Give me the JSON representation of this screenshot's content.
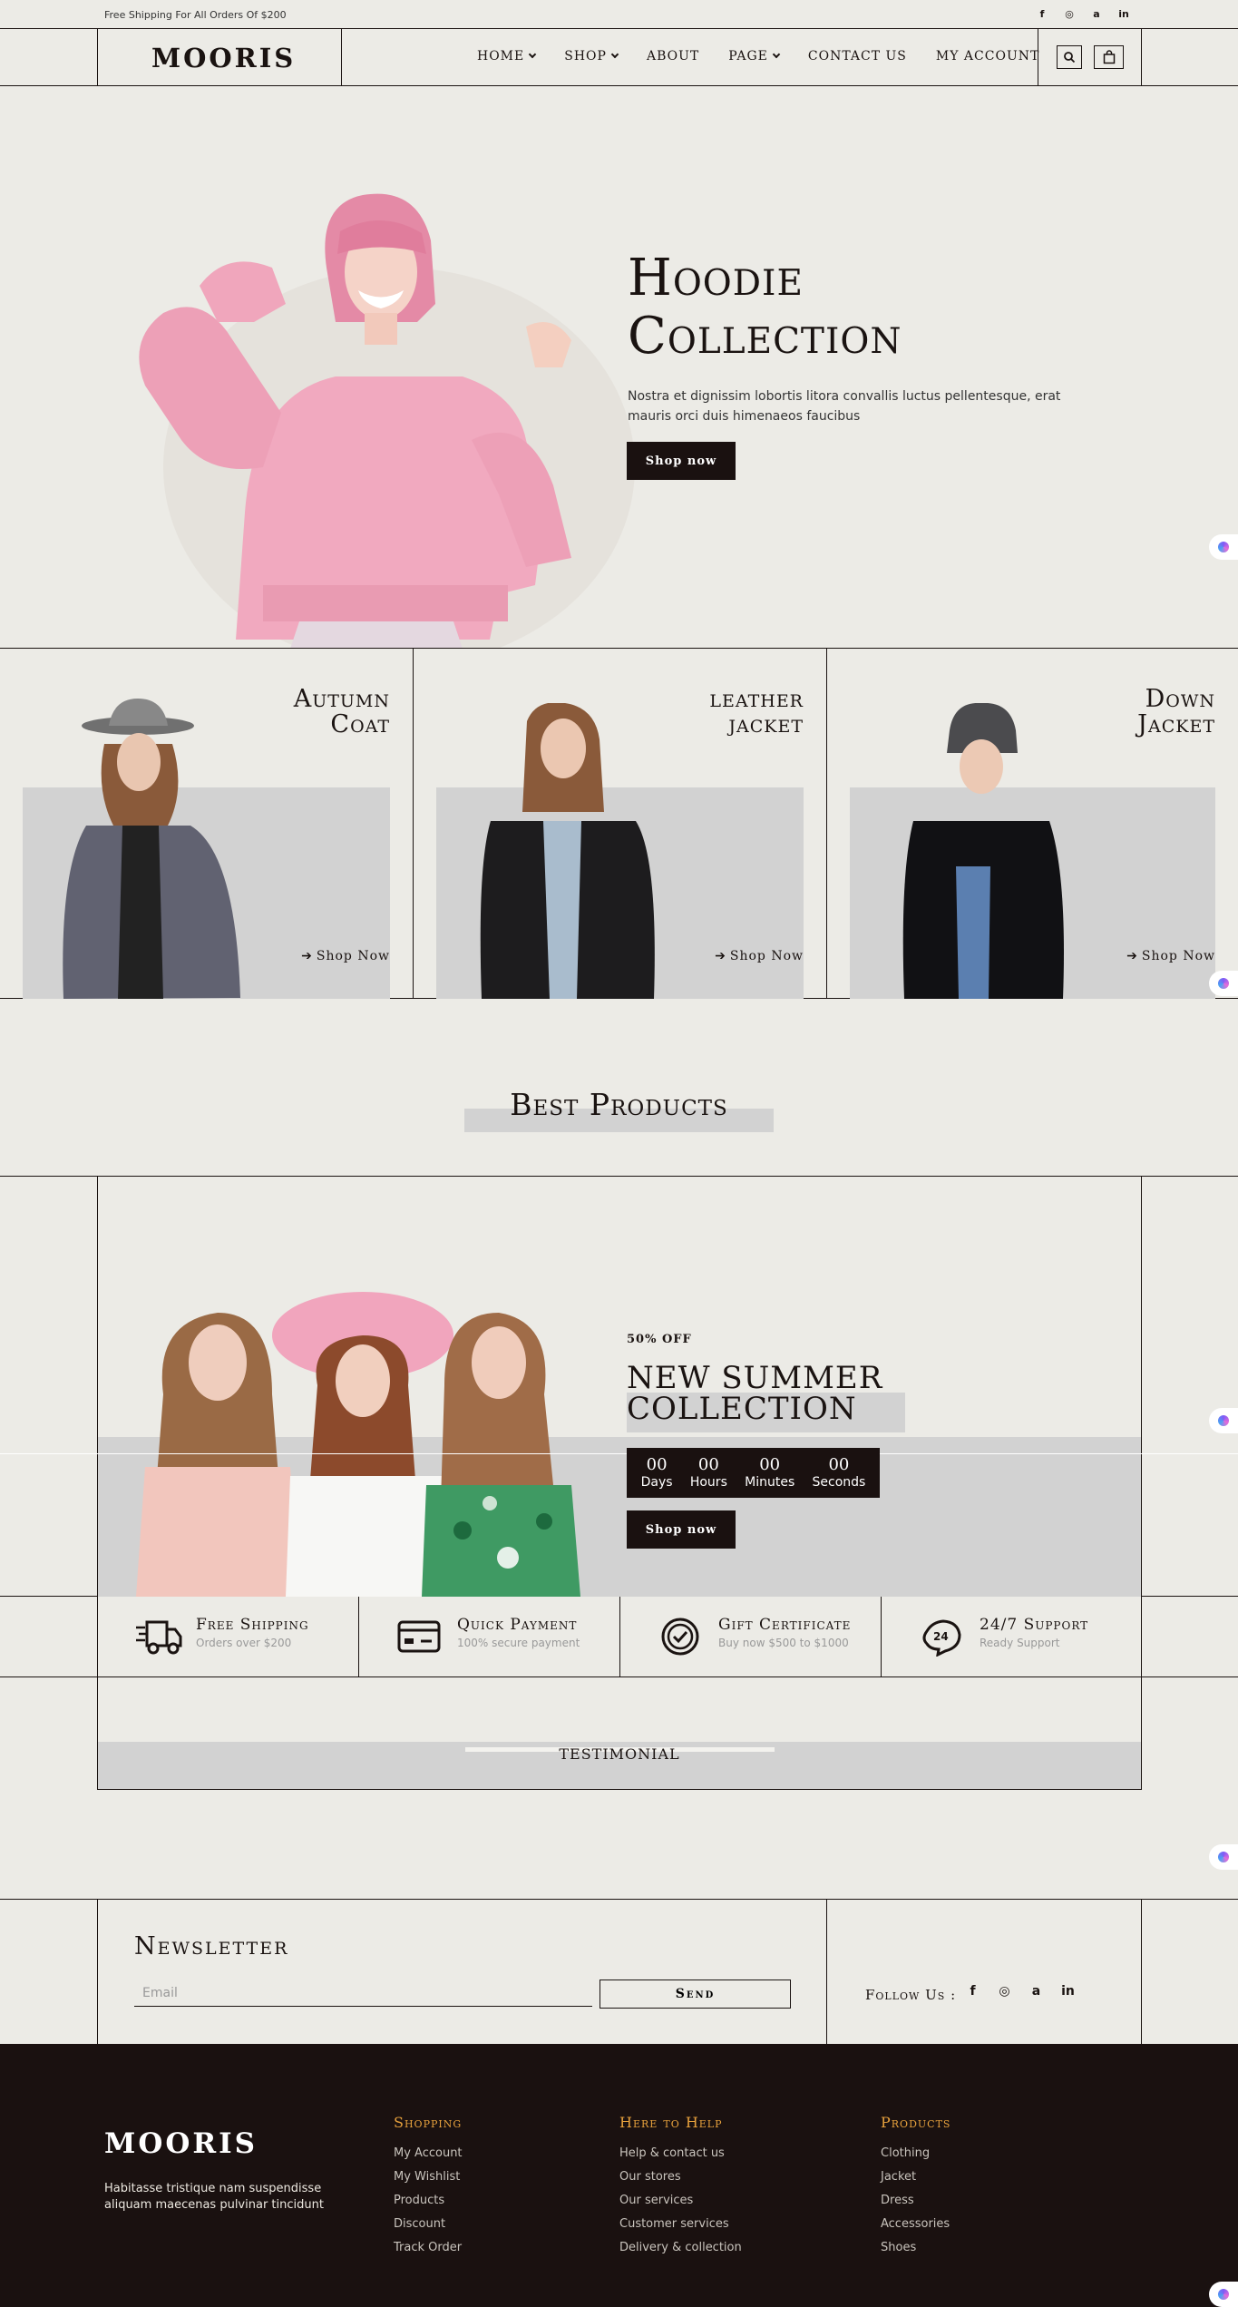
{
  "topbar": {
    "shipping_text": "Free Shipping For All Orders Of $200",
    "socials": [
      "f",
      "◎",
      "a",
      "in"
    ]
  },
  "header": {
    "logo": "MOORIS",
    "nav": [
      {
        "label": "HOME",
        "dropdown": true
      },
      {
        "label": "SHOP",
        "dropdown": true
      },
      {
        "label": "ABOUT",
        "dropdown": false
      },
      {
        "label": "PAGE",
        "dropdown": true
      },
      {
        "label": "CONTACT US",
        "dropdown": false
      },
      {
        "label": "MY ACCOUNT",
        "dropdown": false
      }
    ],
    "icons": [
      "search-icon",
      "shopping-bag-icon"
    ]
  },
  "hero": {
    "title_line1": "Hoodie",
    "title_line2": "Collection",
    "text": "Nostra et dignissim lobortis litora convallis luctus pellentesque, erat mauris orci duis himenaeos faucibus",
    "button": "Shop now"
  },
  "categories": [
    {
      "title_line1": "Autumn",
      "title_line2": "Coat",
      "link": "Shop Now"
    },
    {
      "title_line1": "leather",
      "title_line2": "jacket",
      "link": "Shop Now"
    },
    {
      "title_line1": "Down",
      "title_line2": "Jacket",
      "link": "Shop Now"
    }
  ],
  "best_products": {
    "title": "Best Products"
  },
  "summer": {
    "discount": "50% OFF",
    "title_line1": "NEW SUMMER",
    "title_line2": "COLLECTION",
    "countdown": [
      {
        "value": "00",
        "label": "Days"
      },
      {
        "value": "00",
        "label": "Hours"
      },
      {
        "value": "00",
        "label": "Minutes"
      },
      {
        "value": "00",
        "label": "Seconds"
      }
    ],
    "button": "Shop now"
  },
  "features": [
    {
      "title": "Free Shipping",
      "subtitle": "Orders over $200",
      "icon": "truck-icon"
    },
    {
      "title": "Quick Payment",
      "subtitle": "100% secure payment",
      "icon": "credit-card-icon"
    },
    {
      "title": "Gift Certificate",
      "subtitle": "Buy now $500 to $1000",
      "icon": "check-badge-icon"
    },
    {
      "title": "24/7 Support",
      "subtitle": "Ready Support",
      "icon": "support-24-icon"
    }
  ],
  "testimonial": {
    "title": "TESTIMONIAL"
  },
  "newsletter": {
    "title": "Newsletter",
    "email_placeholder": "Email",
    "send": "Send",
    "follow": "Follow Us :",
    "socials": [
      "f",
      "◎",
      "a",
      "in"
    ]
  },
  "footer": {
    "logo": "MOORIS",
    "description": "Habitasse tristique nam suspendisse aliquam maecenas pulvinar tincidunt",
    "columns": [
      {
        "heading": "Shopping",
        "links": [
          "My Account",
          "My Wishlist",
          "Products",
          "Discount",
          "Track Order"
        ]
      },
      {
        "heading": "Here to Help",
        "links": [
          "Help & contact us",
          "Our stores",
          "Our services",
          "Customer services",
          "Delivery & collection"
        ]
      },
      {
        "heading": "Products",
        "links": [
          "Clothing",
          "Jacket",
          "Dress",
          "Accessories",
          "Shoes"
        ]
      }
    ]
  },
  "colors": {
    "background": "#ecebe6",
    "dark": "#1a1110",
    "accent": "#e8a23d",
    "panel_grey": "#d2d2d2"
  }
}
